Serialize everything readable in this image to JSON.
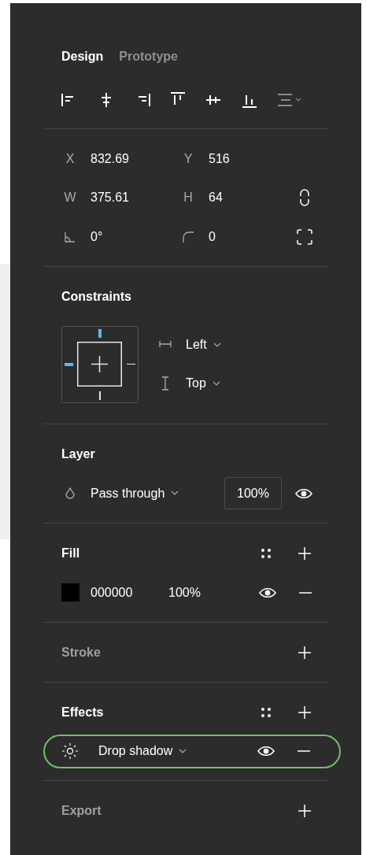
{
  "tabs": [
    {
      "label": "Design",
      "selected": true
    },
    {
      "label": "Prototype",
      "selected": false
    }
  ],
  "align_tools": [
    {
      "kind": "align-left",
      "disabled": false
    },
    {
      "kind": "align-center",
      "disabled": false
    },
    {
      "kind": "align-right",
      "disabled": false
    },
    {
      "kind": "align-top",
      "disabled": false
    },
    {
      "kind": "align-middle",
      "disabled": false
    },
    {
      "kind": "align-bottom",
      "disabled": false
    },
    {
      "kind": "distribute",
      "disabled": true
    }
  ],
  "transform": {
    "rows": [
      {
        "fields": [
          {
            "label": "X",
            "value": "832.69"
          },
          {
            "label": "Y",
            "value": "516"
          }
        ]
      },
      {
        "fields": [
          {
            "label": "W",
            "value": "375.61"
          },
          {
            "label": "H",
            "value": "64"
          }
        ]
      },
      {
        "fields": [
          {
            "kind": "angle",
            "value": "0°"
          },
          {
            "kind": "corner",
            "value": "0"
          }
        ]
      }
    ]
  },
  "constraints": {
    "title": "Constraints",
    "pins": {
      "top": true,
      "left": true,
      "right": false,
      "bottom": false
    },
    "horizontal": "Left",
    "vertical": "Top"
  },
  "layer": {
    "title": "Layer",
    "blend": "Pass through",
    "opacity": "100%",
    "visible": true
  },
  "fill": {
    "title": "Fill",
    "active": true,
    "items": [
      {
        "color": "#000000",
        "hex": "000000",
        "opacity": "100%",
        "visible": true
      }
    ]
  },
  "stroke": {
    "title": "Stroke",
    "active": false
  },
  "effects": {
    "title": "Effects",
    "active": true,
    "items": [
      {
        "name": "Drop shadow",
        "visible": true,
        "highlighted": true
      }
    ]
  },
  "export": {
    "title": "Export",
    "active": false
  }
}
